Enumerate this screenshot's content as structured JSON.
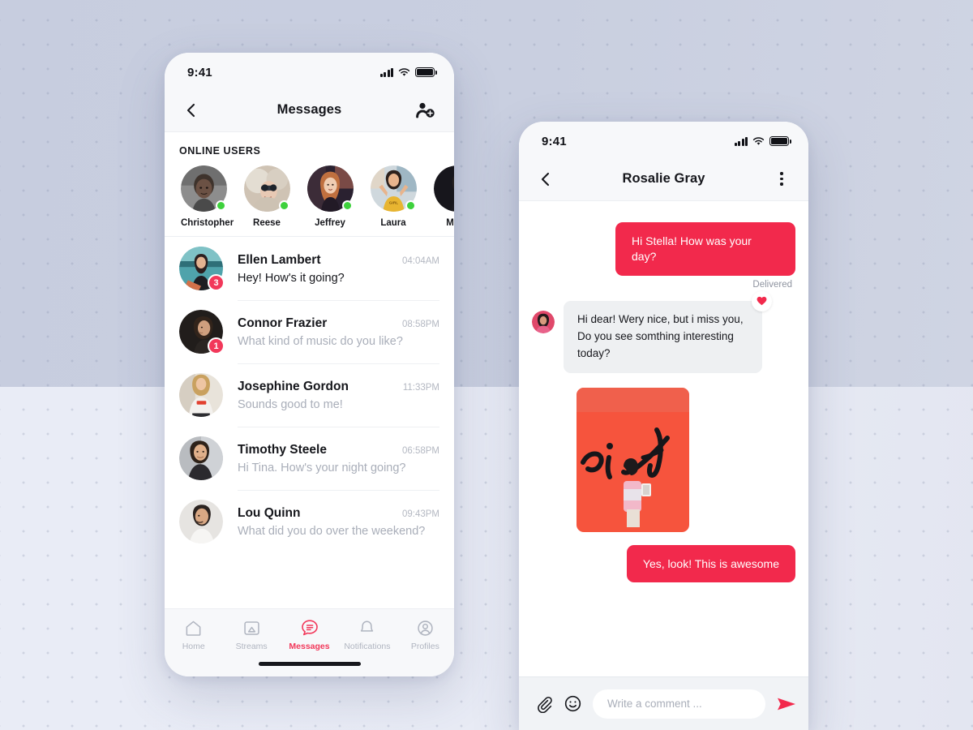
{
  "theme": {
    "accent": "#f2294c",
    "badge": "#f2385a",
    "online_dot": "#3ed13c",
    "bg_top": "#c9cee0",
    "bg_bottom": "#e8ebf5",
    "text_primary": "#15161b",
    "text_muted": "#a9aeb9"
  },
  "messages_screen": {
    "status_bar": {
      "time": "9:41",
      "signal_icon": "cellular-signal-icon",
      "wifi_icon": "wifi-icon",
      "battery_icon": "battery-full-icon"
    },
    "nav": {
      "back_icon": "back-chevron-icon",
      "title": "Messages",
      "action_icon": "add-user-icon"
    },
    "online_section": {
      "label": "ONLINE USERS",
      "users": [
        {
          "name": "Christopher",
          "online": true
        },
        {
          "name": "Reese",
          "online": true
        },
        {
          "name": "Jeffrey",
          "online": true
        },
        {
          "name": "Laura",
          "online": true
        },
        {
          "name": "Malc",
          "online": true
        }
      ]
    },
    "conversations": [
      {
        "name": "Ellen Lambert",
        "time": "04:04AM",
        "preview": "Hey! How's it going?",
        "unread": "3",
        "unread_visible": true
      },
      {
        "name": "Connor Frazier",
        "time": "08:58PM",
        "preview": "What kind of music do you like?",
        "unread": "1",
        "unread_visible": true
      },
      {
        "name": "Josephine Gordon",
        "time": "11:33PM",
        "preview": "Sounds good to me!",
        "unread": "",
        "unread_visible": false
      },
      {
        "name": "Timothy Steele",
        "time": "06:58PM",
        "preview": "Hi Tina. How's your night going?",
        "unread": "",
        "unread_visible": false
      },
      {
        "name": "Lou Quinn",
        "time": "09:43PM",
        "preview": "What did you do over the weekend?",
        "unread": "",
        "unread_visible": false
      }
    ],
    "tabbar": [
      {
        "label": "Home",
        "icon": "home-icon",
        "active": false
      },
      {
        "label": "Streams",
        "icon": "streams-icon",
        "active": false
      },
      {
        "label": "Messages",
        "icon": "messages-icon",
        "active": true
      },
      {
        "label": "Notifications",
        "icon": "bell-icon",
        "active": false
      },
      {
        "label": "Profiles",
        "icon": "profile-icon",
        "active": false
      }
    ]
  },
  "chat_screen": {
    "status_bar": {
      "time": "9:41",
      "signal_icon": "cellular-signal-icon",
      "wifi_icon": "wifi-icon",
      "battery_icon": "battery-full-icon"
    },
    "nav": {
      "back_icon": "back-chevron-icon",
      "title": "Rosalie Gray",
      "action_icon": "kebab-menu-icon"
    },
    "messages": [
      {
        "type": "text",
        "from": "me",
        "text": "Hi Stella! How was your day?",
        "status": "Delivered"
      },
      {
        "type": "text",
        "from": "them",
        "text": "Hi dear! Wery nice, but i miss you, Do you see somthing interesting today?",
        "reaction": "heart-reaction-icon"
      },
      {
        "type": "image",
        "from": "them",
        "alt": "photo-attachment"
      },
      {
        "type": "text",
        "from": "me",
        "text": "Yes, look! This is awesome"
      }
    ],
    "composer": {
      "attach_icon": "paperclip-icon",
      "emoji_icon": "smiley-icon",
      "placeholder": "Write a comment ...",
      "value": "",
      "send_icon": "send-icon"
    }
  }
}
